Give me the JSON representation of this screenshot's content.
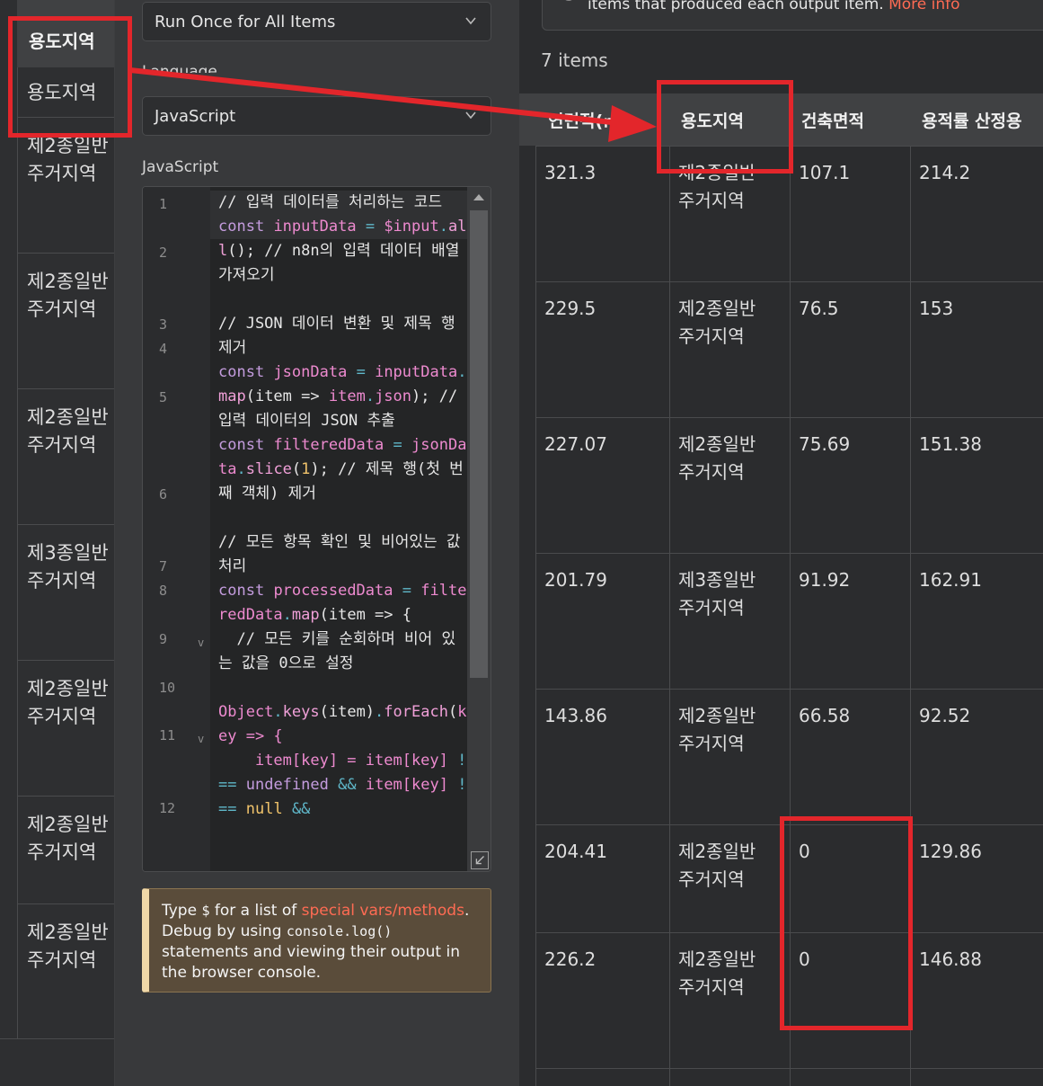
{
  "input_table": {
    "header": "용도지역",
    "sub_header": "용도지역",
    "rows": [
      {
        "line1": "제2종일반",
        "line2": "주거지역"
      },
      {
        "line1": "제2종일반",
        "line2": "주거지역"
      },
      {
        "line1": "제2종일반",
        "line2": "주거지역"
      },
      {
        "line1": "제3종일반",
        "line2": "주거지역"
      },
      {
        "line1": "제2종일반",
        "line2": "주거지역"
      },
      {
        "line1": "제2종일반",
        "line2": "주거지역"
      },
      {
        "line1": "제2종일반",
        "line2": "주거지역"
      }
    ]
  },
  "params": {
    "mode_value": "Run Once for All Items",
    "language_label": "Language",
    "language_value": "JavaScript",
    "code_label": "JavaScript",
    "hint": {
      "prefix": "Type ",
      "dollar": "$",
      "mid": " for a list of ",
      "link": "special vars/methods",
      "after_link": ". Debug by using ",
      "code": "console.log()",
      "suffix": " statements and viewing their output in the browser console."
    }
  },
  "code_lines": [
    {
      "n": "1",
      "fold": ""
    },
    {
      "n": "2",
      "fold": ""
    },
    {
      "n": "3",
      "fold": ""
    },
    {
      "n": "4",
      "fold": ""
    },
    {
      "n": "5",
      "fold": ""
    },
    {
      "n": "6",
      "fold": ""
    },
    {
      "n": "7",
      "fold": ""
    },
    {
      "n": "8",
      "fold": ""
    },
    {
      "n": "9",
      "fold": "v"
    },
    {
      "n": "10",
      "fold": ""
    },
    {
      "n": "11",
      "fold": "v"
    },
    {
      "n": "12",
      "fold": ""
    }
  ],
  "code": {
    "l1": "// 입력 데이터를 처리하는 코드",
    "l2_kw": "const",
    "l2_var": "inputData",
    "l2_op": "=",
    "l2_rest1": "$input",
    "l2_dot": ".",
    "l2_fn": "all",
    "l2_rest2": "(); // n8n의 입력 데이터 배열 가져오기",
    "l4": "// JSON 데이터 변환 및 제목 행 제거",
    "l5_kw": "const",
    "l5_var": "jsonData",
    "l5_op": "=",
    "l5_a": "inputData",
    "l5_fn": "map",
    "l5_b": "(item =>",
    "l5_c": "item",
    "l5_d": "json",
    "l5_e": "); // 입력 데이터의 JSON 추출",
    "l6_kw": "const",
    "l6_var": "filteredData",
    "l6_op": "=",
    "l6_a": "jsonData",
    "l6_fn": "slice",
    "l6_num": "1",
    "l6_e": "); // 제목 행(첫 번째 객체) 제거",
    "l8": "// 모든 항목 확인 및 비어있는 값 처리",
    "l9_kw": "const",
    "l9_var": "processedData",
    "l9_op": "=",
    "l9_a": "filteredData",
    "l9_fn": "map",
    "l9_b": "(item => {",
    "l10": "  // 모든 키를 순회하며 비어 있는 값을 0으로 설정",
    "l11_a": "Object",
    "l11_fn1": "keys",
    "l11_b": "(item)",
    "l11_fn2": "forEach",
    "l11_c": "(",
    "l11_d": "key => {",
    "l12_a": "    item[key] = item[key]",
    "l12_op1": "!==",
    "l12_kw1": "undefined",
    "l12_op2": "&&",
    "l12_b": "item[key]",
    "l12_op3": "!==",
    "l12_kw2": "null",
    "l12_op4": "&&"
  },
  "output": {
    "info_text": "items that produced each output item.",
    "info_link": "More info",
    "items_count": "7 items",
    "headers": [
      "연면적(㎡)",
      "용도지역",
      "건축면적",
      "용적률 산정용"
    ],
    "rows": [
      {
        "area": "321.3",
        "zone1": "제2종일반",
        "zone2": "주거지역",
        "building": "107.1",
        "far": "214.2"
      },
      {
        "area": "229.5",
        "zone1": "제2종일반",
        "zone2": "주거지역",
        "building": "76.5",
        "far": "153"
      },
      {
        "area": "227.07",
        "zone1": "제2종일반",
        "zone2": "주거지역",
        "building": "75.69",
        "far": "151.38"
      },
      {
        "area": "201.79",
        "zone1": "제3종일반",
        "zone2": "주거지역",
        "building": "91.92",
        "far": "162.91"
      },
      {
        "area": "143.86",
        "zone1": "제2종일반",
        "zone2": "주거지역",
        "building": "66.58",
        "far": "92.52"
      },
      {
        "area": "204.41",
        "zone1": "제2종일반",
        "zone2": "주거지역",
        "building": "0",
        "far": "129.86"
      },
      {
        "area": "226.2",
        "zone1": "제2종일반",
        "zone2": "주거지역",
        "building": "0",
        "far": "146.88"
      }
    ]
  },
  "colors": {
    "annotation_red": "#e3262b",
    "link": "#ff6b53"
  }
}
